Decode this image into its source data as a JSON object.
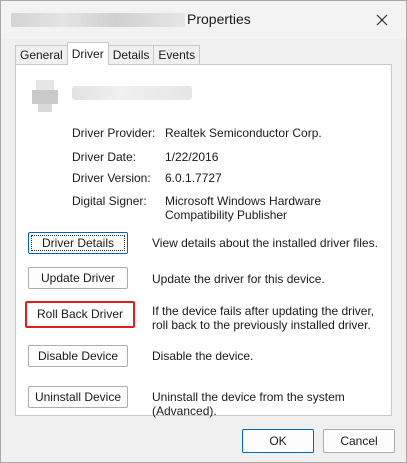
{
  "window": {
    "title": "Properties",
    "close_icon": "close-icon"
  },
  "tabs": [
    {
      "label": "General"
    },
    {
      "label": "Driver"
    },
    {
      "label": "Details"
    },
    {
      "label": "Events"
    }
  ],
  "active_tab": "Driver",
  "device": {
    "icon": "device-icon"
  },
  "info": {
    "provider_label": "Driver Provider:",
    "provider_value": "Realtek Semiconductor Corp.",
    "date_label": "Driver Date:",
    "date_value": "1/22/2016",
    "version_label": "Driver Version:",
    "version_value": "6.0.1.7727",
    "signer_label": "Digital Signer:",
    "signer_value": "Microsoft Windows Hardware Compatibility Publisher"
  },
  "actions": {
    "driver_details_label": "Driver Details",
    "driver_details_desc": "View details about the installed driver files.",
    "update_driver_label": "Update Driver",
    "update_driver_desc": "Update the driver for this device.",
    "roll_back_label": "Roll Back Driver",
    "roll_back_desc": "If the device fails after updating the driver, roll back to the previously installed driver.",
    "disable_label": "Disable Device",
    "disable_desc": "Disable the device.",
    "uninstall_label": "Uninstall Device",
    "uninstall_desc": "Uninstall the device from the system (Advanced)."
  },
  "footer": {
    "ok_label": "OK",
    "cancel_label": "Cancel"
  },
  "colors": {
    "highlight": "#e02020",
    "accent": "#0067c0"
  }
}
